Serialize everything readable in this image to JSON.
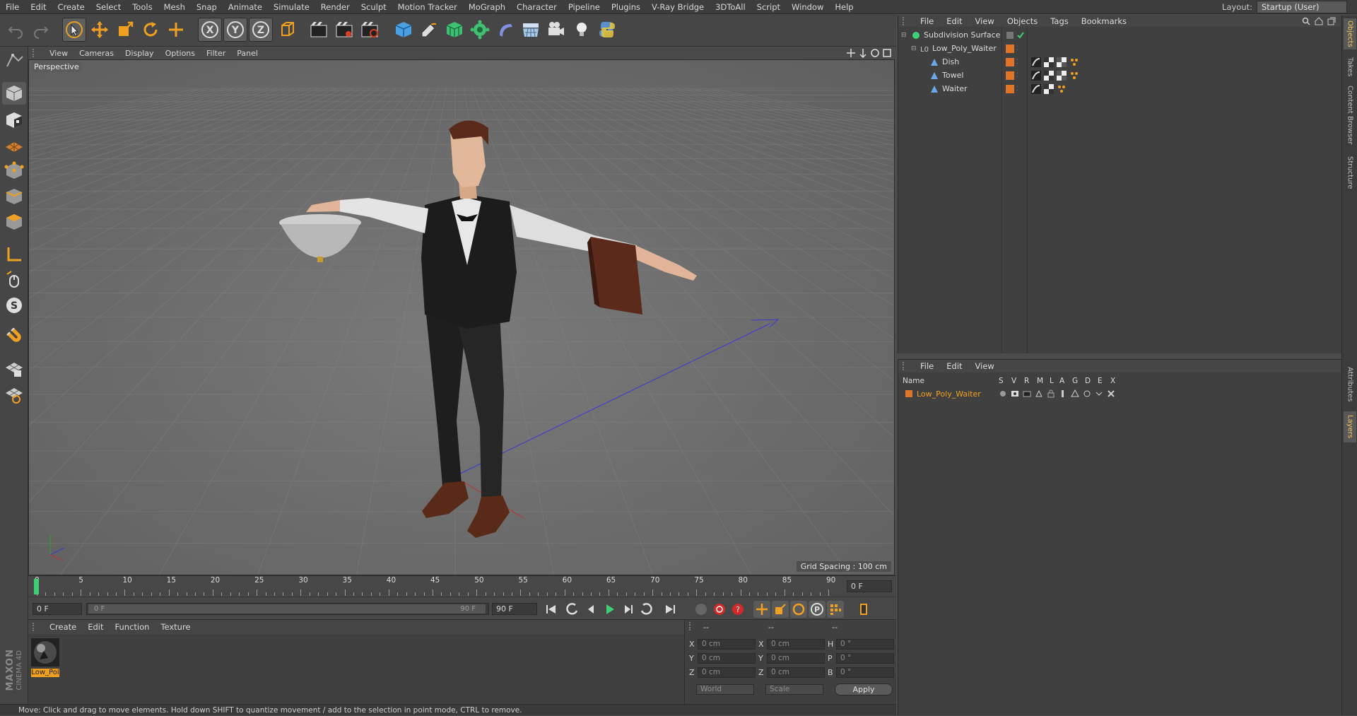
{
  "menubar": {
    "items": [
      "File",
      "Edit",
      "Create",
      "Select",
      "Tools",
      "Mesh",
      "Snap",
      "Animate",
      "Simulate",
      "Render",
      "Sculpt",
      "Motion Tracker",
      "MoGraph",
      "Character",
      "Pipeline",
      "Plugins",
      "V-Ray Bridge",
      "3DToAll",
      "Script",
      "Window",
      "Help"
    ],
    "layout_label": "Layout:",
    "layout_value": "Startup (User)"
  },
  "toolbar": {
    "icons": [
      "undo-icon",
      "redo-icon",
      "select-arrow-icon",
      "move-icon",
      "scale-icon",
      "rotate-icon",
      "live-selection-icon",
      "x-axis-icon",
      "y-axis-icon",
      "z-axis-icon",
      "world-coordinates-icon",
      "render-view-icon",
      "render-picture-viewer-icon",
      "render-settings-icon",
      "cube-icon",
      "pen-icon",
      "subdivision-icon",
      "cloner-icon",
      "deformer-icon",
      "floor-icon",
      "camera-icon",
      "light-icon",
      "python-icon"
    ],
    "axis_labels": [
      "X",
      "Y",
      "Z"
    ]
  },
  "viewport": {
    "menu": [
      "View",
      "Cameras",
      "Display",
      "Options",
      "Filter",
      "Panel"
    ],
    "label": "Perspective",
    "grid_spacing": "Grid Spacing : 100 cm"
  },
  "timeline": {
    "ticks": [
      "0",
      "5",
      "10",
      "15",
      "20",
      "25",
      "30",
      "35",
      "40",
      "45",
      "50",
      "55",
      "60",
      "65",
      "70",
      "75",
      "80",
      "85",
      "90"
    ],
    "current_frame": "0 F"
  },
  "transport": {
    "start_field": "0 F",
    "range_start": "0 F",
    "range_end": "90 F",
    "end_field": "90 F"
  },
  "material_manager": {
    "menu": [
      "Create",
      "Edit",
      "Function",
      "Texture"
    ],
    "materials": [
      {
        "name": "Low_Pol"
      }
    ]
  },
  "coordinates": {
    "header": [
      "--",
      "--",
      "--"
    ],
    "rows": [
      {
        "a": "X",
        "av": "0 cm",
        "b": "X",
        "bv": "0 cm",
        "c": "H",
        "cv": "0 °"
      },
      {
        "a": "Y",
        "av": "0 cm",
        "b": "Y",
        "bv": "0 cm",
        "c": "P",
        "cv": "0 °"
      },
      {
        "a": "Z",
        "av": "0 cm",
        "b": "Z",
        "bv": "0 cm",
        "c": "B",
        "cv": "0 °"
      }
    ],
    "mode_1": "World",
    "mode_2": "Scale",
    "apply": "Apply"
  },
  "status": "Move: Click and drag to move elements. Hold down SHIFT to quantize movement / add to the selection in point mode, CTRL to remove.",
  "object_manager": {
    "menu": [
      "File",
      "Edit",
      "View",
      "Objects",
      "Tags",
      "Bookmarks"
    ],
    "objects": [
      {
        "name": "Subdivision Surface",
        "indent": 0,
        "type": "subdivision"
      },
      {
        "name": "Low_Poly_Waiter",
        "indent": 1,
        "type": "null"
      },
      {
        "name": "Dish",
        "indent": 2,
        "type": "bone"
      },
      {
        "name": "Towel",
        "indent": 2,
        "type": "bone"
      },
      {
        "name": "Waiter",
        "indent": 2,
        "type": "bone"
      }
    ]
  },
  "layer_manager": {
    "menu": [
      "File",
      "Edit",
      "View"
    ],
    "columns": [
      "Name",
      "S",
      "V",
      "R",
      "M",
      "L",
      "A",
      "G",
      "D",
      "E",
      "X"
    ],
    "layers": [
      {
        "name": "Low_Poly_Waiter",
        "color": "#e0752a"
      }
    ]
  },
  "right_tabs": [
    "Objects",
    "Takes",
    "Content Browser",
    "Structure",
    "Attributes",
    "Layers"
  ],
  "brand": {
    "line1": "MAXON",
    "line2": "CINEMA 4D"
  },
  "colors": {
    "accent": "#e0752a",
    "highlight": "#f0c060",
    "active_green": "#3fd073"
  }
}
